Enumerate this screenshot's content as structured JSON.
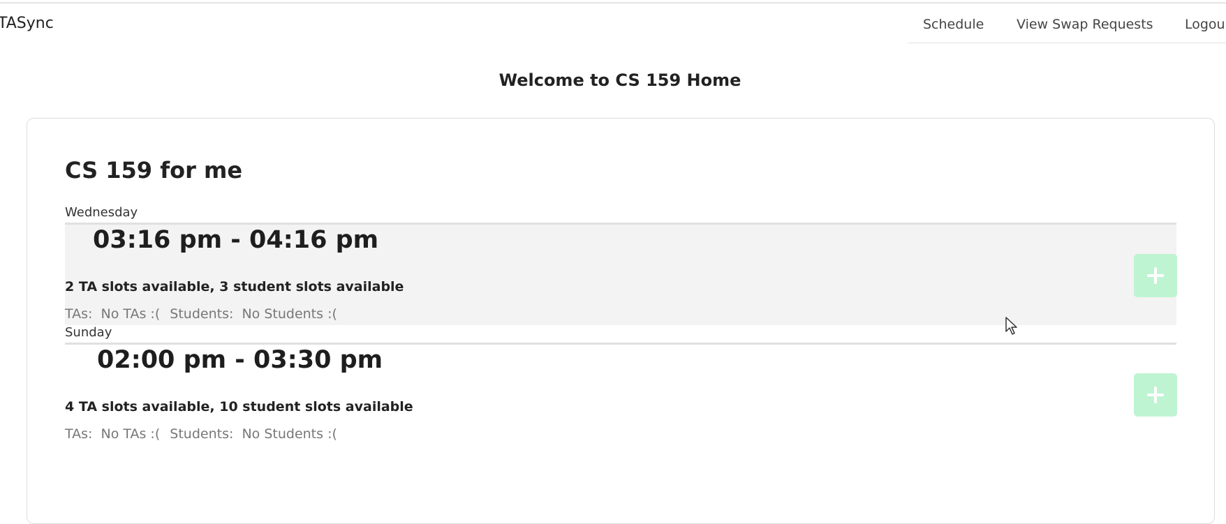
{
  "navbar": {
    "brand": "TASync",
    "links": [
      {
        "label": "Schedule"
      },
      {
        "label": "View Swap Requests"
      },
      {
        "label": "Logou"
      }
    ]
  },
  "page": {
    "welcome": "Welcome to CS 159 Home"
  },
  "course": {
    "title": "CS 159 for me",
    "slots": [
      {
        "day": "Wednesday",
        "time": "03:16 pm - 04:16 pm",
        "availability": "2 TA slots available, 3 student slots available",
        "tas_label": "TAs:",
        "tas_value": "No TAs :(",
        "students_label": "Students:",
        "students_value": "No Students :(",
        "add_icon": "plus-icon"
      },
      {
        "day": "Sunday",
        "time": "02:00 pm - 03:30 pm",
        "availability": "4 TA slots available, 10 student slots available",
        "tas_label": "TAs:",
        "tas_value": "No TAs :(",
        "students_label": "Students:",
        "students_value": "No Students :(",
        "add_icon": "plus-icon"
      }
    ]
  },
  "colors": {
    "add_button": "#bff4d2",
    "highlight_row": "#f3f3f3"
  }
}
